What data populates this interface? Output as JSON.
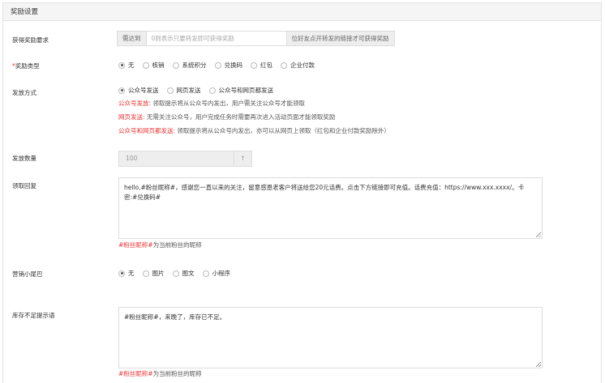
{
  "panel": {
    "title": "奖励设置"
  },
  "requirement": {
    "label": "获得奖励要求",
    "prefix": "需达到",
    "placeholder": "0则表示只要转发即可获得奖励",
    "suffix": "位好友点开转发的链接才可获得奖励"
  },
  "reward_type": {
    "required_mark": "*",
    "label": "奖励类型",
    "options": [
      "无",
      "核销",
      "系统积分",
      "兑换码",
      "红包",
      "企业付款"
    ],
    "selected": 0
  },
  "send_method": {
    "label": "发放方式",
    "options": [
      "公众号发送",
      "网页发送",
      "公众号和网页都发送"
    ],
    "selected": 0,
    "notes": [
      {
        "key": "公众号发放:",
        "text": " 领取提示将从公众号内发出，用户需关注公众号才能领取"
      },
      {
        "key": "网页发送:",
        "text": " 无需关注公众号，用户完成任务时需要再次进入活动页面才能领取奖励"
      },
      {
        "key": "公众号和网页都发送:",
        "text": " 领取提示将从公众号内发出，亦可以从网页上领取（红包和企业付款奖励除外）"
      }
    ]
  },
  "quantity": {
    "label": "发放数量",
    "value": "100",
    "step_icon": "up-arrow"
  },
  "reply": {
    "label": "领取回复",
    "text": "hello,#粉丝昵称#，感谢您一直以来的关注，留意感恩老客户将送给您20元话费。点击下方链接即可充值。话费充值：https://www.xxx.xxxx/。卡密:#兑换码#",
    "hint_key": "#粉丝昵称#",
    "hint_text": "为当前粉丝的昵称"
  },
  "tail": {
    "label": "营销小尾巴",
    "options": [
      "无",
      "图片",
      "图文",
      "小程序"
    ],
    "selected": 0
  },
  "stock_tip": {
    "label": "库存不足提示语",
    "text": "#粉丝昵称#，来晚了，库存已不足。",
    "hint_key": "#粉丝昵称#",
    "hint_text": "为当前粉丝的昵称"
  }
}
